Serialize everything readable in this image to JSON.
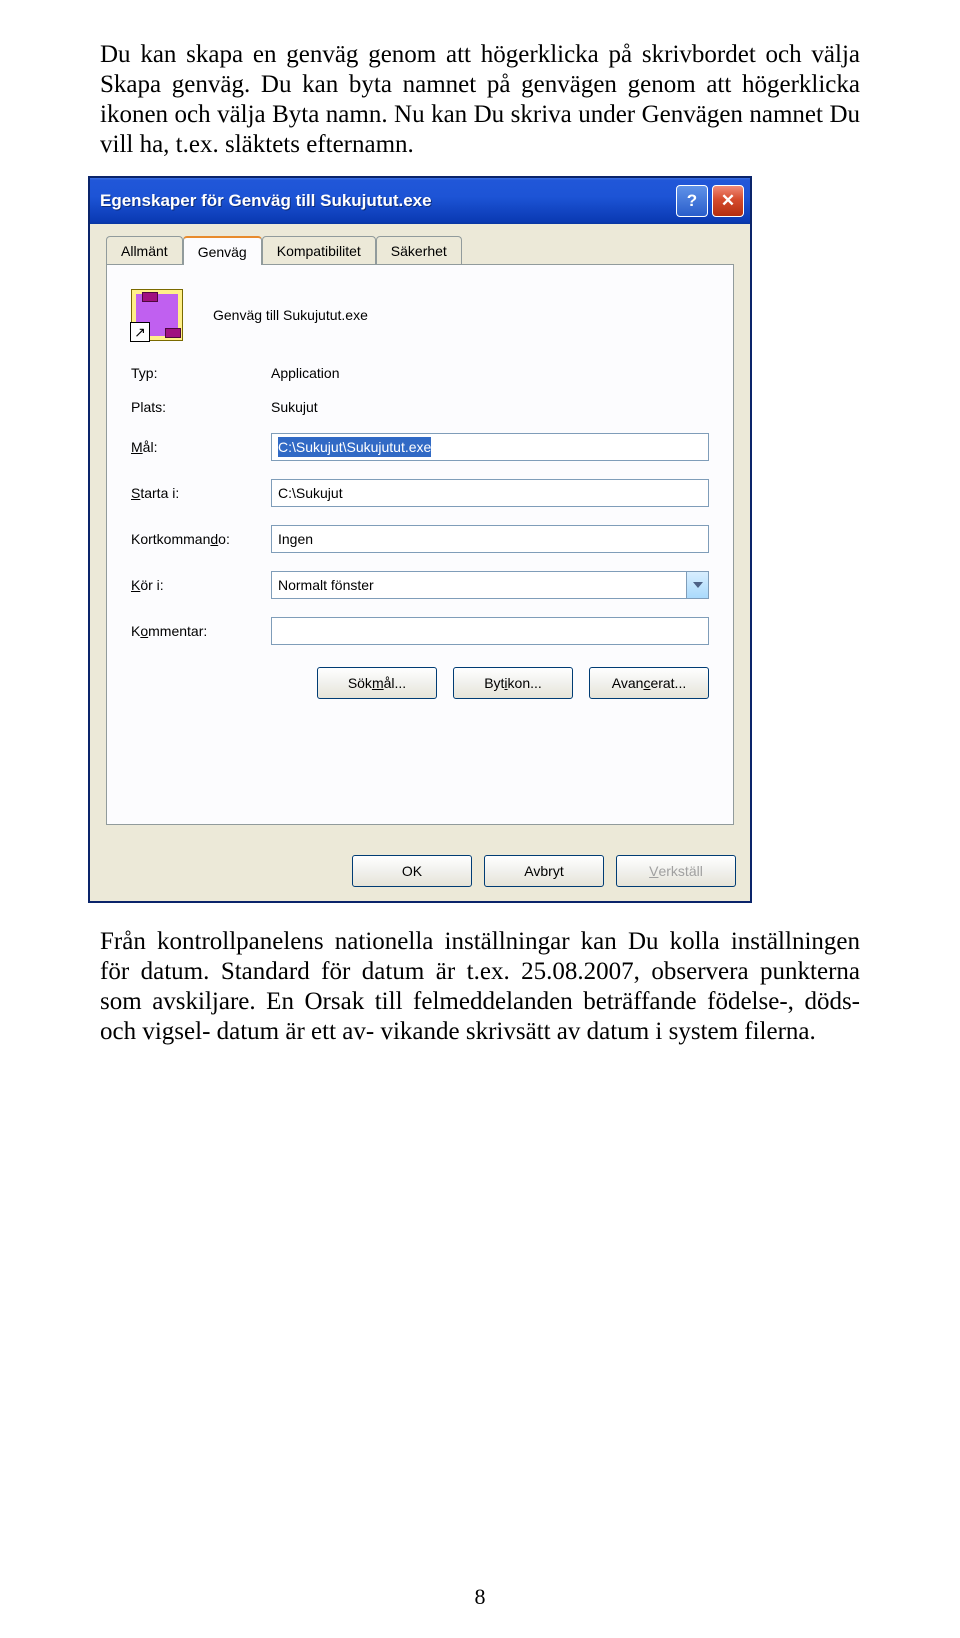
{
  "para1": "Du kan skapa en genväg genom att högerklicka på skrivbordet och välja Skapa genväg. Du kan byta namnet på genvägen genom att högerklicka ikonen och välja Byta namn. Nu kan Du skriva under Genvägen namnet Du vill ha, t.ex. släktets efternamn.",
  "para2": "Från kontrollpanelens nationella inställningar kan Du kolla inställningen för datum. Standard för datum är t.ex. 25.08.2007, observera punkterna som avskiljare. En Orsak till felmeddelanden beträffande födelse-, döds- och vigsel- datum är ett av- vikande skrivsätt av datum i system filerna.",
  "dialog": {
    "title": "Egenskaper för Genväg till Sukujutut.exe",
    "tabs": {
      "allmant": "Allmänt",
      "genvag": "Genväg",
      "kompat": "Kompatibilitet",
      "sakerhet": "Säkerhet"
    },
    "icon_label": "Genväg till Sukujutut.exe",
    "labels": {
      "typ": "Typ:",
      "plats": "Plats:",
      "mal": "Mål:",
      "starta": "Starta i:",
      "kort": "Kortkommando:",
      "kor": "Kör i:",
      "kommentar": "Kommentar:"
    },
    "values": {
      "typ": "Application",
      "plats": "Sukujut",
      "mal": "C:\\Sukujut\\Sukujutut.exe",
      "starta": "C:\\Sukujut",
      "kort": "Ingen",
      "kor": "Normalt fönster",
      "kommentar": ""
    },
    "buttons": {
      "sokmal_pre": "Sök ",
      "sokmal_ul": "m",
      "sokmal_post": "ål...",
      "bytikon_pre": "Byt ",
      "bytikon_ul": "i",
      "bytikon_post": "kon...",
      "avancerat_pre": "Avan",
      "avancerat_ul": "c",
      "avancerat_post": "erat..."
    },
    "footer": {
      "ok": "OK",
      "avbryt": "Avbryt",
      "verkstall_ul": "V",
      "verkstall_post": "erkställ"
    },
    "label_ul": {
      "mal": "M",
      "mal_post": "ål:",
      "starta": "S",
      "starta_post": "tarta i:",
      "kort_pre": "Kortkomman",
      "kort_ul": "d",
      "kort_post": "o:",
      "kor": "K",
      "kor_post": "ör i:",
      "komm": "K",
      "komm_ul": "o",
      "komm_post": "mmentar:"
    }
  },
  "page_number": "8"
}
